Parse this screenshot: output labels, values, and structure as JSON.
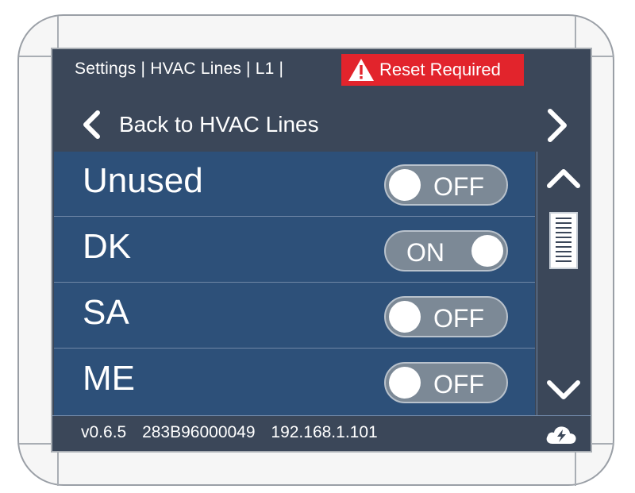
{
  "header": {
    "breadcrumb": "Settings | HVAC Lines | L1 |",
    "alert_label": "Reset Required",
    "alert_color": "#e2242c"
  },
  "nav": {
    "back_label": "Back to HVAC Lines",
    "back_icon": "chevron-left-icon",
    "next_icon": "chevron-right-icon"
  },
  "settings": [
    {
      "label": "Unused",
      "state": "OFF"
    },
    {
      "label": "DK",
      "state": "ON"
    },
    {
      "label": "SA",
      "state": "OFF"
    },
    {
      "label": "ME",
      "state": "OFF"
    }
  ],
  "scroll": {
    "up_icon": "chevron-up-icon",
    "down_icon": "chevron-down-icon"
  },
  "footer": {
    "version": "v0.6.5",
    "serial": "283B96000049",
    "ip": "192.168.1.101",
    "status_icon": "cloud-sync-icon"
  },
  "colors": {
    "screen_bg": "#3b4759",
    "list_bg": "#2d5079",
    "toggle_bg": "#7c8996"
  }
}
